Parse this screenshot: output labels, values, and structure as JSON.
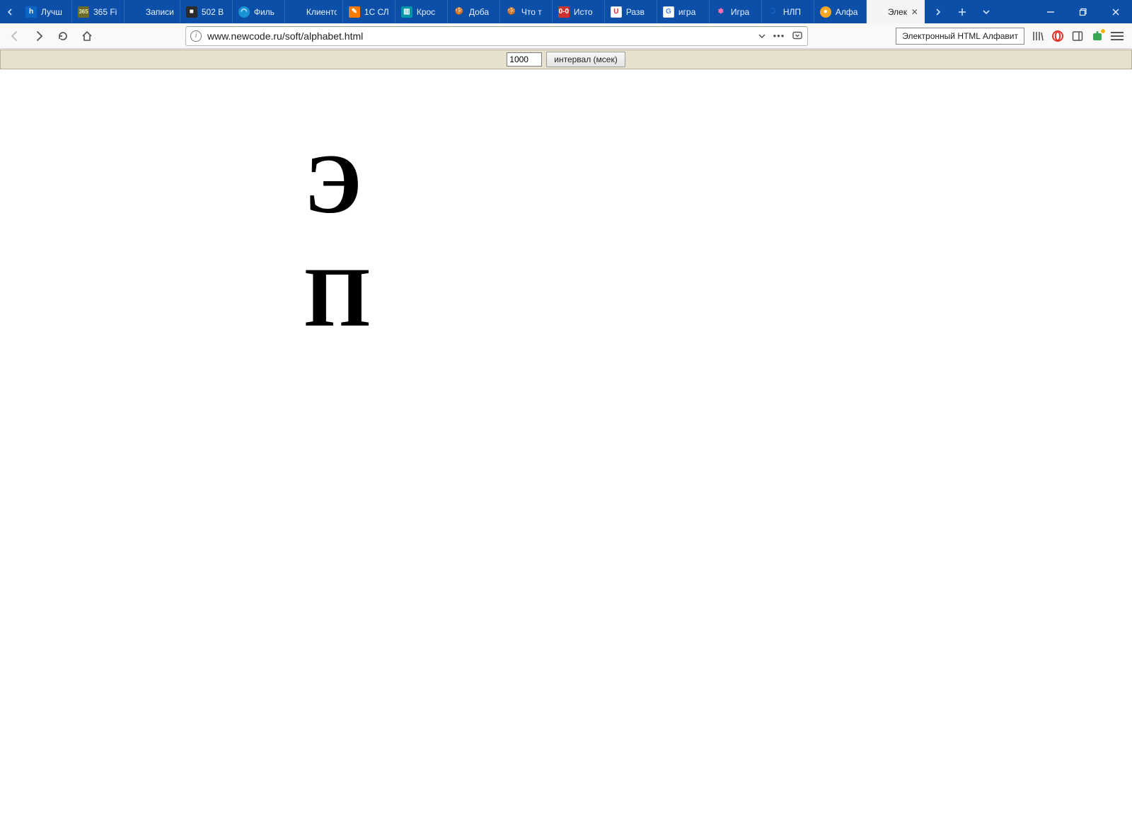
{
  "tabs": [
    {
      "label": "Лучш",
      "fav": "h",
      "favClass": "fav-blue"
    },
    {
      "label": "365 Fi",
      "fav": "365",
      "favClass": "fav-olive"
    },
    {
      "label": "Записи",
      "fav": "",
      "favClass": "fav-none"
    },
    {
      "label": "502 B",
      "fav": "■",
      "favClass": "fav-dark"
    },
    {
      "label": "Филь",
      "fav": "◠",
      "favClass": "fav-head"
    },
    {
      "label": "Клиентск",
      "fav": "",
      "favClass": "fav-none"
    },
    {
      "label": "1С СЛ",
      "fav": "✎",
      "favClass": "fav-orange"
    },
    {
      "label": "Крос",
      "fav": "▥",
      "favClass": "fav-teal"
    },
    {
      "label": "Доба",
      "fav": "🍪",
      "favClass": "fav-none fav-cookie"
    },
    {
      "label": "Что т",
      "fav": "🍪",
      "favClass": "fav-none fav-cookie"
    },
    {
      "label": "Исто",
      "fav": "0-0",
      "favClass": "fav-red"
    },
    {
      "label": "Разв",
      "fav": "U",
      "favClass": "fav-red"
    },
    {
      "label": "игра",
      "fav": "G",
      "favClass": "fav-google"
    },
    {
      "label": "Игра",
      "fav": "✽",
      "favClass": "fav-none fav-flower"
    },
    {
      "label": "НЛП",
      "fav": "ꓛ",
      "favClass": "fav-none fav-nlp"
    },
    {
      "label": "Алфа",
      "fav": "●",
      "favClass": "fav-gold"
    },
    {
      "label": "Электр",
      "fav": "",
      "favClass": "fav-none",
      "active": true
    }
  ],
  "url": "www.newcode.ru/soft/alphabet.html",
  "page_title_box": "Электронный HTML Алфавит",
  "panel": {
    "interval_value": "1000",
    "interval_button": "интервал (мсек)"
  },
  "letters": {
    "line1": "Э",
    "line2": "П"
  }
}
